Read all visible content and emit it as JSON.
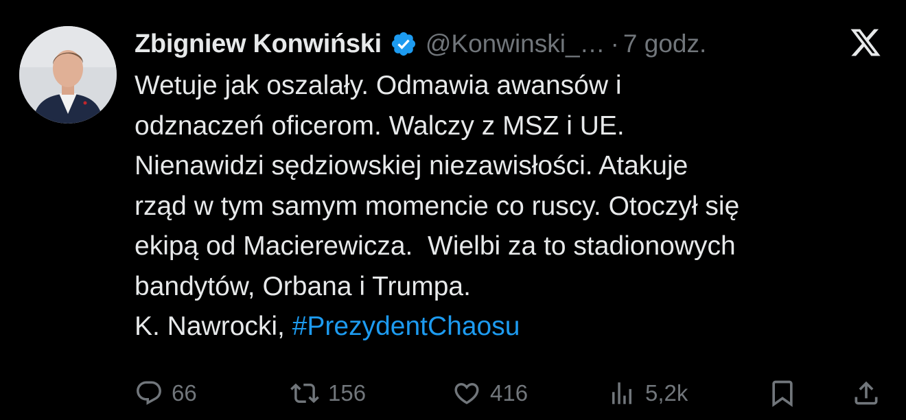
{
  "author": {
    "display_name": "Zbigniew Konwiński",
    "handle": "@Konwinski_…",
    "separator": "·",
    "time": "7 godz.",
    "verified": true
  },
  "body": {
    "lines": [
      "Wetuje jak oszalały. Odmawia awansów i",
      "odznaczeń oficerom. Walczy z MSZ i UE.",
      "Nienawidzi sędziowskiej niezawisłości. Atakuje",
      "rząd w tym samym momencie co ruscy. Otoczył się",
      "ekipą od Macierewicza.  Wielbi za to stadionowych",
      "bandytów, Orbana i Trumpa."
    ],
    "signature": "K. Nawrocki, ",
    "hashtag": "#PrezydentChaosu"
  },
  "actions": {
    "replies": "66",
    "reposts": "156",
    "likes": "416",
    "views": "5,2k"
  },
  "icons": {
    "verified": "verified-badge-icon",
    "brand": "x-logo-icon",
    "reply": "reply-icon",
    "repost": "repost-icon",
    "like": "heart-icon",
    "views": "views-icon",
    "bookmark": "bookmark-icon",
    "share": "share-icon"
  },
  "colors": {
    "background": "#000000",
    "text": "#e7e9ea",
    "muted": "#71767b",
    "link": "#1d9bf0",
    "verified": "#1d9bf0"
  }
}
